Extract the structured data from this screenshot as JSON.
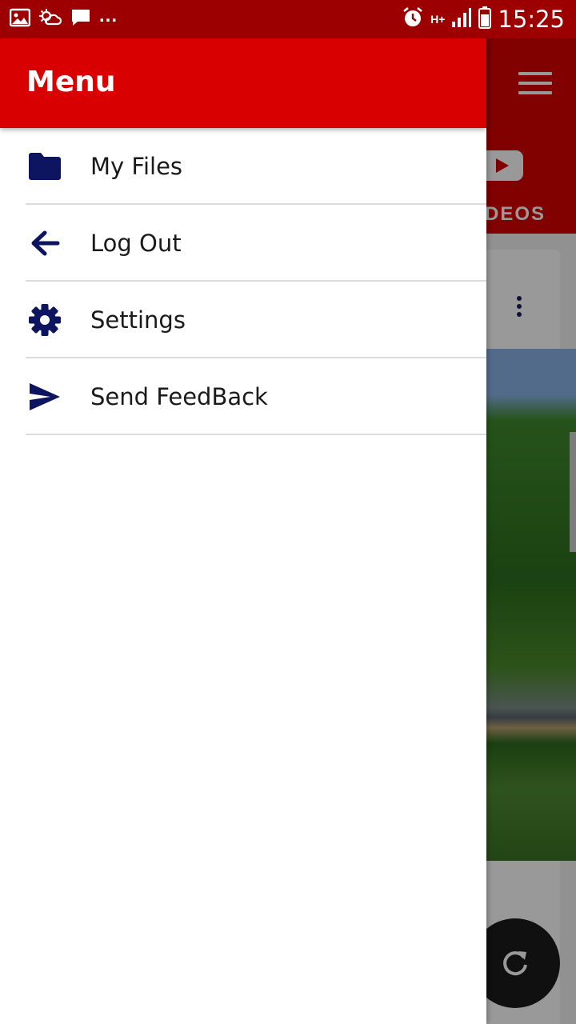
{
  "status_bar": {
    "time": "15:25",
    "overflow": "...",
    "network": "H+",
    "icons": [
      "image-icon",
      "weather-icon",
      "chat-icon",
      "alarm-icon",
      "network-type-icon",
      "signal-icon",
      "battery-icon"
    ]
  },
  "drawer": {
    "title": "Menu",
    "items": [
      {
        "label": "My Files",
        "icon": "folder-icon"
      },
      {
        "label": "Log Out",
        "icon": "arrow-left-icon"
      },
      {
        "label": "Settings",
        "icon": "gear-icon"
      },
      {
        "label": "Send FeedBack",
        "icon": "send-icon"
      }
    ]
  },
  "background": {
    "tab_label_visible": "DEOS",
    "icons": [
      "menu-icon",
      "youtube-icon",
      "more-vert-icon",
      "refresh-icon"
    ]
  },
  "colors": {
    "primary_red": "#d80000",
    "status_bar_red": "#9c0000",
    "icon_navy": "#0d1460",
    "fab_dark": "#1c1c1c"
  }
}
